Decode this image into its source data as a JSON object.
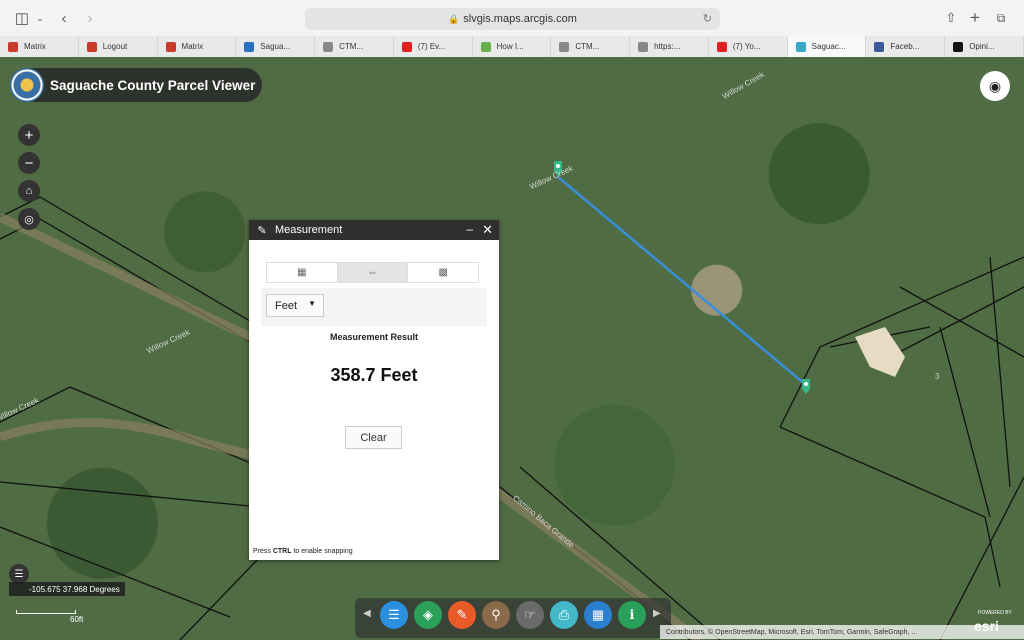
{
  "browser": {
    "url": "slvgis.maps.arcgis.com",
    "tabs": [
      {
        "label": "Matrix",
        "color": "#c83b2b"
      },
      {
        "label": "Logout",
        "color": "#c83b2b"
      },
      {
        "label": "Matrix",
        "color": "#c83b2b"
      },
      {
        "label": "Sagua...",
        "color": "#2a70c0"
      },
      {
        "label": "CTM...",
        "color": "#888888"
      },
      {
        "label": "(7) Ev...",
        "color": "#e02020"
      },
      {
        "label": "How I...",
        "color": "#6ab04c"
      },
      {
        "label": "CTM...",
        "color": "#888888"
      },
      {
        "label": "https:...",
        "color": "#888888"
      },
      {
        "label": "(7) Yo...",
        "color": "#e02020"
      },
      {
        "label": "Saguac...",
        "color": "#3aa8c8",
        "active": true
      },
      {
        "label": "Faceb...",
        "color": "#3b5998"
      },
      {
        "label": "Opini...",
        "color": "#111111"
      }
    ]
  },
  "app": {
    "title": "Saguache County Parcel Viewer"
  },
  "map": {
    "road_labels": [
      "Willow Creek",
      "Willow Creek",
      "Willow Creek",
      "Willow Creek",
      "Camino Baca Grande"
    ],
    "parcel_number": "3"
  },
  "measurement": {
    "title": "Measurement",
    "unit": "Feet",
    "result_label": "Measurement Result",
    "result_value": "358.7 Feet",
    "clear_label": "Clear",
    "snap_prefix": "Press ",
    "snap_key": "CTRL",
    "snap_suffix": " to enable snapping"
  },
  "status": {
    "coordinates": "-105.675 37.968 Degrees",
    "scale_label": "60ft"
  },
  "attribution": {
    "text": "Contributors, © OpenStreetMap, Microsoft, Esri, TomTom, Garmin, SafeGraph, ...",
    "powered_by": "POWERED BY",
    "esri": "esri"
  },
  "colors": {
    "measure_line": "#3a8fd8",
    "marker": "#39b58a",
    "parcel_line": "#111111"
  }
}
